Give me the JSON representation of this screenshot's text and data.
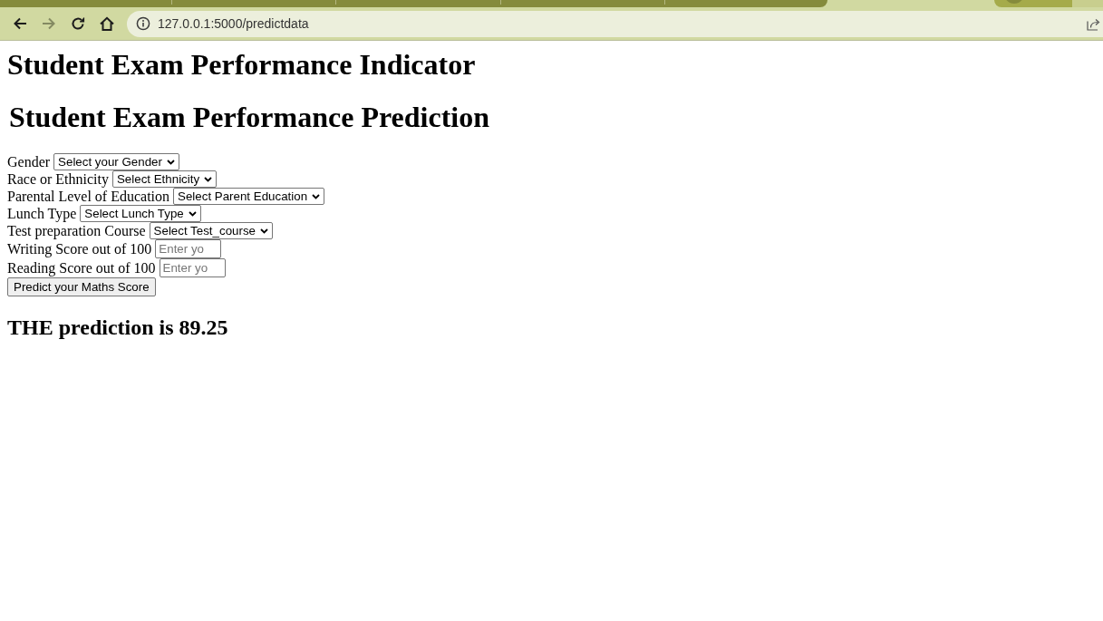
{
  "browser": {
    "nav_buttons": [
      {
        "kind": "back",
        "disabled": false
      },
      {
        "kind": "forward",
        "disabled": true
      },
      {
        "kind": "reload",
        "disabled": false
      },
      {
        "kind": "home",
        "disabled": false
      }
    ],
    "address": "127.0.0.1:5000/predictdata"
  },
  "page": {
    "title": "Student Exam Performance Indicator",
    "form_title": "Student Exam Performance Prediction",
    "fields": [
      {
        "kind": "select",
        "label": "Gender",
        "value": "Select your Gender"
      },
      {
        "kind": "select",
        "label": "Race or Ethnicity",
        "value": "Select Ethnicity"
      },
      {
        "kind": "select",
        "label": "Parental Level of Education",
        "value": "Select Parent Education"
      },
      {
        "kind": "select",
        "label": "Lunch Type",
        "value": "Select Lunch Type"
      },
      {
        "kind": "select",
        "label": "Test preparation Course",
        "value": "Select Test_course"
      },
      {
        "kind": "number",
        "label": "Writing Score out of 100",
        "placeholder": "Enter yo"
      },
      {
        "kind": "number",
        "label": "Reading Score out of 100",
        "placeholder": "Enter yo"
      }
    ],
    "submit": "Predict your Maths Score",
    "result": "THE prediction is 89.25"
  }
}
